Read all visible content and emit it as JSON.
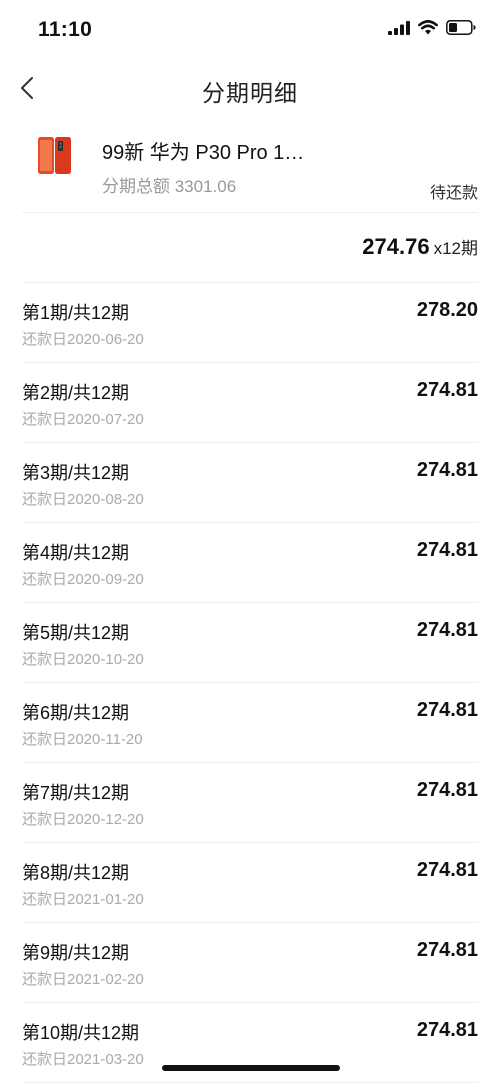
{
  "status_bar": {
    "time": "11:10",
    "icons": [
      "signal-icon",
      "wifi-icon",
      "battery-icon"
    ]
  },
  "nav": {
    "title": "分期明细",
    "back_icon": "chevron-left-icon"
  },
  "product": {
    "name": "99新 华为 P30 Pro 1…",
    "total_text": "分期总额 3301.06",
    "status": "待还款",
    "thumbnail_color": "#e8492b"
  },
  "summary": {
    "amount": "274.76",
    "count": "x12期"
  },
  "installments": [
    {
      "period": "第1期/共12期",
      "date": "还款日2020-06-20",
      "amount": "278.20"
    },
    {
      "period": "第2期/共12期",
      "date": "还款日2020-07-20",
      "amount": "274.81"
    },
    {
      "period": "第3期/共12期",
      "date": "还款日2020-08-20",
      "amount": "274.81"
    },
    {
      "period": "第4期/共12期",
      "date": "还款日2020-09-20",
      "amount": "274.81"
    },
    {
      "period": "第5期/共12期",
      "date": "还款日2020-10-20",
      "amount": "274.81"
    },
    {
      "period": "第6期/共12期",
      "date": "还款日2020-11-20",
      "amount": "274.81"
    },
    {
      "period": "第7期/共12期",
      "date": "还款日2020-12-20",
      "amount": "274.81"
    },
    {
      "period": "第8期/共12期",
      "date": "还款日2021-01-20",
      "amount": "274.81"
    },
    {
      "period": "第9期/共12期",
      "date": "还款日2021-02-20",
      "amount": "274.81"
    },
    {
      "period": "第10期/共12期",
      "date": "还款日2021-03-20",
      "amount": "274.81"
    }
  ]
}
